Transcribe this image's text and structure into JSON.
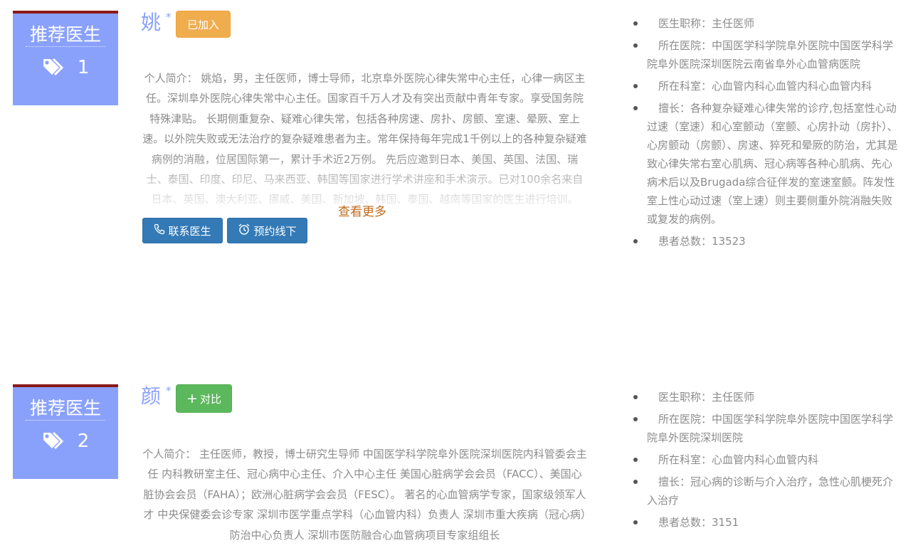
{
  "colors": {
    "badge": "#8aa1fb",
    "badge_top": "#8b1a1a",
    "joined": "#f0ad4e",
    "compare": "#5cb85c",
    "primary": "#337ab7",
    "more_link": "#c26a1b"
  },
  "doctors": [
    {
      "badge_title": "推荐医生",
      "badge_icon": "tags-icon",
      "badge_number": "1",
      "name": "姚",
      "star": "*",
      "action_label": "已加入",
      "intro": "个人简介： 姚焰，男，主任医师，博士导师，北京阜外医院心律失常中心主任，心律一病区主任。深圳阜外医院心律失常中心主任。国家百千万人才及有突出贡献中青年专家。享受国务院特殊津贴。 长期侧重复杂、疑难心律失常，包括各种房速、房扑、房颤、室速、晕厥、室上速。以外院失败或无法治疗的复杂疑难患者为主。常年保持每年完成1千例以上的各种复杂疑难病例的消融，位居国际第一，累计手术近2万例。 先后应邀到日本、美国、英国、法国、瑞士、泰国、印度、印尼、马来西亚、韩国等国家进行学术讲座和手术演示。已对100余名来自日本、英国、澳大利亚、挪威、美国、新加坡、韩国、泰国、越南等国家的医生进行培训。",
      "more_label": "查看更多",
      "contact_label": "联系医生",
      "contact_icon": "phone-icon",
      "appoint_label": "预约线下",
      "appoint_icon": "alarm-clock-icon",
      "info": {
        "title": "医生职称：主任医师",
        "hospital": "所在医院：中国医学科学院阜外医院中国医学科学院阜外医院深圳医院云南省阜外心血管病医院",
        "department": "所在科室：心血管内科心血管内科心血管内科",
        "specialty": "擅长：各种复杂疑难心律失常的诊疗,包括室性心动过速（室速）和心室颤动（室颤、心房扑动（房扑）、心房颤动（房颤）、房速、猝死和晕厥的防治，尤其是致心律失常右室心肌病、冠心病等各种心肌病、先心病术后以及Brugada综合征伴发的室速室颤。阵发性室上性心动过速（室上速）则主要侧重外院消融失败或复发的病例。",
        "patients": "患者总数：13523"
      }
    },
    {
      "badge_title": "推荐医生",
      "badge_icon": "tags-icon",
      "badge_number": "2",
      "name": "颜",
      "star": "*",
      "action_plus": "+",
      "action_label": "对比",
      "intro": "个人简介： 主任医师，教授，博士研究生导师 中国医学科学院阜外医院深圳医院内科管委会主任 内科教研室主任、冠心病中心主任、介入中心主任 美国心脏病学会会员（FACC）、美国心脏协会会员（FAHA）；欧洲心脏病学会会员（FESC）。 著名的心血管病学专家，国家级领军人才 中央保健委会诊专家 深圳市医学重点学科（心血管内科）负责人 深圳市重大疾病（冠心病）防治中心负责人 深圳市医防融合心血管病项目专家组组长",
      "info": {
        "title": "医生职称：主任医师",
        "hospital": "所在医院：中国医学科学院阜外医院中国医学科学院阜外医院深圳医院",
        "department": "所在科室：心血管内科心血管内科",
        "specialty": "擅长：冠心病的诊断与介入治疗，急性心肌梗死介入治疗",
        "patients": "患者总数：3151"
      }
    }
  ]
}
